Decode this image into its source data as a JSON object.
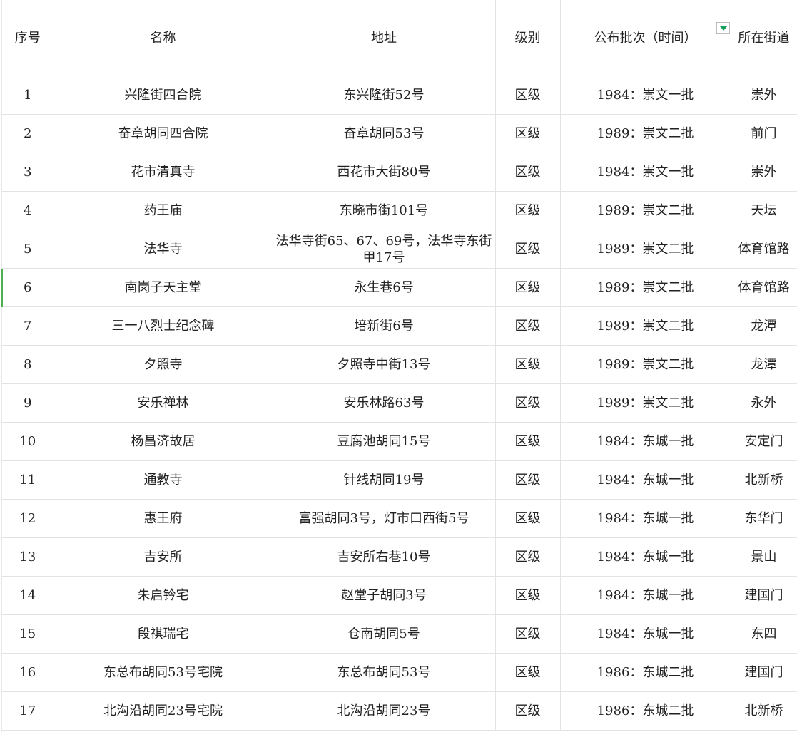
{
  "headers": {
    "seq": "序号",
    "name": "名称",
    "address": "地址",
    "level": "级别",
    "batch": "公布批次（时间）",
    "street": "所在街道"
  },
  "filter_icon": "filter-dropdown-icon",
  "accent_color": "#16a05d",
  "rows": [
    {
      "seq": "1",
      "name": "兴隆街四合院",
      "address": "东兴隆街52号",
      "level": "区级",
      "batch": "1984：崇文一批",
      "street": "崇外"
    },
    {
      "seq": "2",
      "name": "奋章胡同四合院",
      "address": "奋章胡同53号",
      "level": "区级",
      "batch": "1989：崇文二批",
      "street": "前门"
    },
    {
      "seq": "3",
      "name": "花市清真寺",
      "address": "西花市大街80号",
      "level": "区级",
      "batch": "1984：崇文一批",
      "street": "崇外"
    },
    {
      "seq": "4",
      "name": "药王庙",
      "address": "东晓市街101号",
      "level": "区级",
      "batch": "1989：崇文二批",
      "street": "天坛"
    },
    {
      "seq": "5",
      "name": "法华寺",
      "address": "法华寺街65、67、69号，法华寺东街甲17号",
      "level": "区级",
      "batch": "1989：崇文二批",
      "street": "体育馆路"
    },
    {
      "seq": "6",
      "name": "南岗子天主堂",
      "address": "永生巷6号",
      "level": "区级",
      "batch": "1989：崇文二批",
      "street": "体育馆路"
    },
    {
      "seq": "7",
      "name": "三一八烈士纪念碑",
      "address": "培新街6号",
      "level": "区级",
      "batch": "1989：崇文二批",
      "street": "龙潭"
    },
    {
      "seq": "8",
      "name": "夕照寺",
      "address": "夕照寺中街13号",
      "level": "区级",
      "batch": "1989：崇文二批",
      "street": "龙潭"
    },
    {
      "seq": "9",
      "name": "安乐禅林",
      "address": "安乐林路63号",
      "level": "区级",
      "batch": "1989：崇文二批",
      "street": "永外"
    },
    {
      "seq": "10",
      "name": "杨昌济故居",
      "address": "豆腐池胡同15号",
      "level": "区级",
      "batch": "1984：东城一批",
      "street": "安定门"
    },
    {
      "seq": "11",
      "name": "通教寺",
      "address": "针线胡同19号",
      "level": "区级",
      "batch": "1984：东城一批",
      "street": "北新桥"
    },
    {
      "seq": "12",
      "name": "惠王府",
      "address": "富强胡同3号，灯市口西街5号",
      "level": "区级",
      "batch": "1984：东城一批",
      "street": "东华门"
    },
    {
      "seq": "13",
      "name": "吉安所",
      "address": "吉安所右巷10号",
      "level": "区级",
      "batch": "1984：东城一批",
      "street": "景山"
    },
    {
      "seq": "14",
      "name": "朱启钤宅",
      "address": "赵堂子胡同3号",
      "level": "区级",
      "batch": "1984：东城一批",
      "street": "建国门"
    },
    {
      "seq": "15",
      "name": "段祺瑞宅",
      "address": "仓南胡同5号",
      "level": "区级",
      "batch": "1984：东城一批",
      "street": "东四"
    },
    {
      "seq": "16",
      "name": "东总布胡同53号宅院",
      "address": "东总布胡同53号",
      "level": "区级",
      "batch": "1986：东城二批",
      "street": "建国门"
    },
    {
      "seq": "17",
      "name": "北沟沿胡同23号宅院",
      "address": "北沟沿胡同23号",
      "level": "区级",
      "batch": "1986：东城二批",
      "street": "北新桥"
    }
  ]
}
